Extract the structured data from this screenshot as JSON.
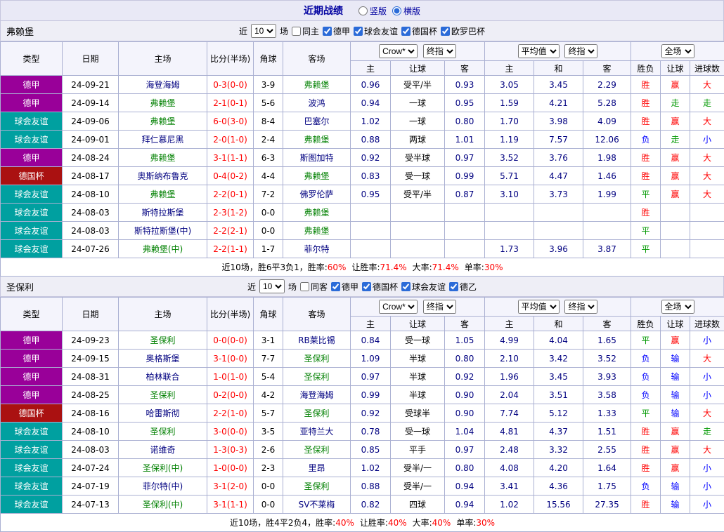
{
  "topbar": {
    "title": "近期战绩",
    "radios": [
      {
        "label": "竖版",
        "checked": false
      },
      {
        "label": "横版",
        "checked": true
      }
    ]
  },
  "columns": {
    "type": "类型",
    "date": "日期",
    "home": "主场",
    "score": "比分(半场)",
    "corner": "角球",
    "away": "客场",
    "asia_home": "主",
    "asia_handicap": "让球",
    "asia_away": "客",
    "euro_home": "主",
    "euro_draw": "和",
    "euro_away": "客",
    "result": "胜负",
    "handicap_result": "让球",
    "goals": "进球数"
  },
  "colors": {
    "league_dejia": "#990099",
    "league_friendly": "#00a0a0",
    "league_cup": "#aa1111",
    "win": "#ff0000",
    "loss": "#0000ff",
    "draw": "#009900",
    "focus_team": "#008000",
    "team": "#000080",
    "score": "#ff0000"
  },
  "sections": [
    {
      "team": "弗赖堡",
      "filter": {
        "near": "近",
        "count": "10",
        "games": "场",
        "same": "同主",
        "same_checked": false,
        "leagues": [
          "德甲",
          "球会友谊",
          "德国杯",
          "欧罗巴杯"
        ]
      },
      "selects": {
        "company": "Crow*",
        "asia_type": "终指",
        "euro_avg": "平均值",
        "euro_type": "终指",
        "scope": "全场"
      },
      "rows": [
        {
          "league": "德甲",
          "lc": "lg-purple",
          "date": "24-09-21",
          "home": "海登海姆",
          "hf": false,
          "score": "0-3(0-0)",
          "corner": "3-9",
          "away": "弗赖堡",
          "af": true,
          "asia": [
            "0.96",
            "受平/半",
            "0.93"
          ],
          "euro": [
            "3.05",
            "3.45",
            "2.29"
          ],
          "res": [
            [
              "胜",
              "red"
            ],
            [
              "赢",
              "red"
            ],
            [
              "大",
              "red"
            ]
          ]
        },
        {
          "league": "德甲",
          "lc": "lg-purple",
          "date": "24-09-14",
          "home": "弗赖堡",
          "hf": true,
          "score": "2-1(0-1)",
          "corner": "5-6",
          "away": "波鸿",
          "af": false,
          "asia": [
            "0.94",
            "一球",
            "0.95"
          ],
          "euro": [
            "1.59",
            "4.21",
            "5.28"
          ],
          "res": [
            [
              "胜",
              "red"
            ],
            [
              "走",
              "green"
            ],
            [
              "走",
              "green"
            ]
          ]
        },
        {
          "league": "球会友谊",
          "lc": "lg-teal",
          "date": "24-09-06",
          "home": "弗赖堡",
          "hf": true,
          "score": "6-0(3-0)",
          "corner": "8-4",
          "away": "巴塞尔",
          "af": false,
          "asia": [
            "1.02",
            "一球",
            "0.80"
          ],
          "euro": [
            "1.70",
            "3.98",
            "4.09"
          ],
          "res": [
            [
              "胜",
              "red"
            ],
            [
              "赢",
              "red"
            ],
            [
              "大",
              "red"
            ]
          ]
        },
        {
          "league": "球会友谊",
          "lc": "lg-teal",
          "date": "24-09-01",
          "home": "拜仁慕尼黑",
          "hf": false,
          "score": "2-0(1-0)",
          "corner": "2-4",
          "away": "弗赖堡",
          "af": true,
          "asia": [
            "0.88",
            "两球",
            "1.01"
          ],
          "euro": [
            "1.19",
            "7.57",
            "12.06"
          ],
          "res": [
            [
              "负",
              "blue"
            ],
            [
              "走",
              "green"
            ],
            [
              "小",
              "blue"
            ]
          ]
        },
        {
          "league": "德甲",
          "lc": "lg-purple",
          "date": "24-08-24",
          "home": "弗赖堡",
          "hf": true,
          "score": "3-1(1-1)",
          "corner": "6-3",
          "away": "斯图加特",
          "af": false,
          "asia": [
            "0.92",
            "受半球",
            "0.97"
          ],
          "euro": [
            "3.52",
            "3.76",
            "1.98"
          ],
          "res": [
            [
              "胜",
              "red"
            ],
            [
              "赢",
              "red"
            ],
            [
              "大",
              "red"
            ]
          ]
        },
        {
          "league": "德国杯",
          "lc": "lg-darkred",
          "date": "24-08-17",
          "home": "奥斯纳布鲁克",
          "hf": false,
          "score": "0-4(0-2)",
          "corner": "4-4",
          "away": "弗赖堡",
          "af": true,
          "asia": [
            "0.83",
            "受一球",
            "0.99"
          ],
          "euro": [
            "5.71",
            "4.47",
            "1.46"
          ],
          "res": [
            [
              "胜",
              "red"
            ],
            [
              "赢",
              "red"
            ],
            [
              "大",
              "red"
            ]
          ]
        },
        {
          "league": "球会友谊",
          "lc": "lg-teal",
          "date": "24-08-10",
          "home": "弗赖堡",
          "hf": true,
          "score": "2-2(0-1)",
          "corner": "7-2",
          "away": "佛罗伦萨",
          "af": false,
          "asia": [
            "0.95",
            "受平/半",
            "0.87"
          ],
          "euro": [
            "3.10",
            "3.73",
            "1.99"
          ],
          "res": [
            [
              "平",
              "green"
            ],
            [
              "赢",
              "red"
            ],
            [
              "大",
              "red"
            ]
          ]
        },
        {
          "league": "球会友谊",
          "lc": "lg-teal",
          "date": "24-08-03",
          "home": "斯特拉斯堡",
          "hf": false,
          "score": "2-3(1-2)",
          "corner": "0-0",
          "away": "弗赖堡",
          "af": true,
          "asia": [
            "",
            "",
            ""
          ],
          "euro": [
            "",
            "",
            ""
          ],
          "res": [
            [
              "胜",
              "red"
            ],
            [
              "",
              ""
            ],
            [
              "",
              ""
            ]
          ]
        },
        {
          "league": "球会友谊",
          "lc": "lg-teal",
          "date": "24-08-03",
          "home": "斯特拉斯堡(中)",
          "hf": false,
          "score": "2-2(2-1)",
          "corner": "0-0",
          "away": "弗赖堡",
          "af": true,
          "asia": [
            "",
            "",
            ""
          ],
          "euro": [
            "",
            "",
            ""
          ],
          "res": [
            [
              "平",
              "green"
            ],
            [
              "",
              ""
            ],
            [
              "",
              ""
            ]
          ]
        },
        {
          "league": "球会友谊",
          "lc": "lg-teal",
          "date": "24-07-26",
          "home": "弗赖堡(中)",
          "hf": true,
          "score": "2-2(1-1)",
          "corner": "1-7",
          "away": "菲尔特",
          "af": false,
          "asia": [
            "",
            "",
            ""
          ],
          "euro": [
            "1.73",
            "3.96",
            "3.87"
          ],
          "res": [
            [
              "平",
              "green"
            ],
            [
              "",
              ""
            ],
            [
              "",
              ""
            ]
          ]
        }
      ],
      "summary": [
        [
          "近10场，胜6平3负1，胜率:",
          "dark"
        ],
        [
          "60%",
          "red"
        ],
        [
          "让胜率:",
          "dark"
        ],
        [
          "71.4%",
          "red"
        ],
        [
          "大率:",
          "dark"
        ],
        [
          "71.4%",
          "red"
        ],
        [
          "单率:",
          "dark"
        ],
        [
          "30%",
          "red"
        ]
      ]
    },
    {
      "team": "圣保利",
      "filter": {
        "near": "近",
        "count": "10",
        "games": "场",
        "same": "同客",
        "same_checked": false,
        "leagues": [
          "德甲",
          "德国杯",
          "球会友谊",
          "德乙"
        ]
      },
      "selects": {
        "company": "Crow*",
        "asia_type": "终指",
        "euro_avg": "平均值",
        "euro_type": "终指",
        "scope": "全场"
      },
      "rows": [
        {
          "league": "德甲",
          "lc": "lg-purple",
          "date": "24-09-23",
          "home": "圣保利",
          "hf": true,
          "score": "0-0(0-0)",
          "corner": "3-1",
          "away": "RB莱比锡",
          "af": false,
          "asia": [
            "0.84",
            "受一球",
            "1.05"
          ],
          "euro": [
            "4.99",
            "4.04",
            "1.65"
          ],
          "res": [
            [
              "平",
              "green"
            ],
            [
              "赢",
              "red"
            ],
            [
              "小",
              "blue"
            ]
          ]
        },
        {
          "league": "德甲",
          "lc": "lg-purple",
          "date": "24-09-15",
          "home": "奥格斯堡",
          "hf": false,
          "score": "3-1(0-0)",
          "corner": "7-7",
          "away": "圣保利",
          "af": true,
          "asia": [
            "1.09",
            "半球",
            "0.80"
          ],
          "euro": [
            "2.10",
            "3.42",
            "3.52"
          ],
          "res": [
            [
              "负",
              "blue"
            ],
            [
              "输",
              "blue"
            ],
            [
              "大",
              "red"
            ]
          ]
        },
        {
          "league": "德甲",
          "lc": "lg-purple",
          "date": "24-08-31",
          "home": "柏林联合",
          "hf": false,
          "score": "1-0(1-0)",
          "corner": "5-4",
          "away": "圣保利",
          "af": true,
          "asia": [
            "0.97",
            "半球",
            "0.92"
          ],
          "euro": [
            "1.96",
            "3.45",
            "3.93"
          ],
          "res": [
            [
              "负",
              "blue"
            ],
            [
              "输",
              "blue"
            ],
            [
              "小",
              "blue"
            ]
          ]
        },
        {
          "league": "德甲",
          "lc": "lg-purple",
          "date": "24-08-25",
          "home": "圣保利",
          "hf": true,
          "score": "0-2(0-0)",
          "corner": "4-2",
          "away": "海登海姆",
          "af": false,
          "asia": [
            "0.99",
            "半球",
            "0.90"
          ],
          "euro": [
            "2.04",
            "3.51",
            "3.58"
          ],
          "res": [
            [
              "负",
              "blue"
            ],
            [
              "输",
              "blue"
            ],
            [
              "小",
              "blue"
            ]
          ]
        },
        {
          "league": "德国杯",
          "lc": "lg-darkred",
          "date": "24-08-16",
          "home": "哈雷斯彻",
          "hf": false,
          "score": "2-2(1-0)",
          "corner": "5-7",
          "away": "圣保利",
          "af": true,
          "asia": [
            "0.92",
            "受球半",
            "0.90"
          ],
          "euro": [
            "7.74",
            "5.12",
            "1.33"
          ],
          "res": [
            [
              "平",
              "green"
            ],
            [
              "输",
              "blue"
            ],
            [
              "大",
              "red"
            ]
          ]
        },
        {
          "league": "球会友谊",
          "lc": "lg-teal",
          "date": "24-08-10",
          "home": "圣保利",
          "hf": true,
          "score": "3-0(0-0)",
          "corner": "3-5",
          "away": "亚特兰大",
          "af": false,
          "asia": [
            "0.78",
            "受一球",
            "1.04"
          ],
          "euro": [
            "4.81",
            "4.37",
            "1.51"
          ],
          "res": [
            [
              "胜",
              "red"
            ],
            [
              "赢",
              "red"
            ],
            [
              "走",
              "green"
            ]
          ]
        },
        {
          "league": "球会友谊",
          "lc": "lg-teal",
          "date": "24-08-03",
          "home": "诺维奇",
          "hf": false,
          "score": "1-3(0-3)",
          "corner": "2-6",
          "away": "圣保利",
          "af": true,
          "asia": [
            "0.85",
            "平手",
            "0.97"
          ],
          "euro": [
            "2.48",
            "3.32",
            "2.55"
          ],
          "res": [
            [
              "胜",
              "red"
            ],
            [
              "赢",
              "red"
            ],
            [
              "大",
              "red"
            ]
          ]
        },
        {
          "league": "球会友谊",
          "lc": "lg-teal",
          "date": "24-07-24",
          "home": "圣保利(中)",
          "hf": true,
          "score": "1-0(0-0)",
          "corner": "2-3",
          "away": "里昂",
          "af": false,
          "asia": [
            "1.02",
            "受半/一",
            "0.80"
          ],
          "euro": [
            "4.08",
            "4.20",
            "1.64"
          ],
          "res": [
            [
              "胜",
              "red"
            ],
            [
              "赢",
              "red"
            ],
            [
              "小",
              "blue"
            ]
          ]
        },
        {
          "league": "球会友谊",
          "lc": "lg-teal",
          "date": "24-07-19",
          "home": "菲尔特(中)",
          "hf": false,
          "score": "3-1(2-0)",
          "corner": "0-0",
          "away": "圣保利",
          "af": true,
          "asia": [
            "0.88",
            "受半/一",
            "0.94"
          ],
          "euro": [
            "3.41",
            "4.36",
            "1.75"
          ],
          "res": [
            [
              "负",
              "blue"
            ],
            [
              "输",
              "blue"
            ],
            [
              "小",
              "blue"
            ]
          ]
        },
        {
          "league": "球会友谊",
          "lc": "lg-teal",
          "date": "24-07-13",
          "home": "圣保利(中)",
          "hf": true,
          "score": "3-1(1-1)",
          "corner": "0-0",
          "away": "SV不莱梅",
          "af": false,
          "asia": [
            "0.82",
            "四球",
            "0.94"
          ],
          "euro": [
            "1.02",
            "15.56",
            "27.35"
          ],
          "res": [
            [
              "胜",
              "red"
            ],
            [
              "输",
              "blue"
            ],
            [
              "小",
              "blue"
            ]
          ]
        }
      ],
      "summary": [
        [
          "近10场，胜4平2负4，胜率:",
          "dark"
        ],
        [
          "40%",
          "red"
        ],
        [
          "让胜率:",
          "dark"
        ],
        [
          "40%",
          "red"
        ],
        [
          "大率:",
          "dark"
        ],
        [
          "40%",
          "red"
        ],
        [
          "单率:",
          "dark"
        ],
        [
          "30%",
          "red"
        ]
      ]
    }
  ]
}
